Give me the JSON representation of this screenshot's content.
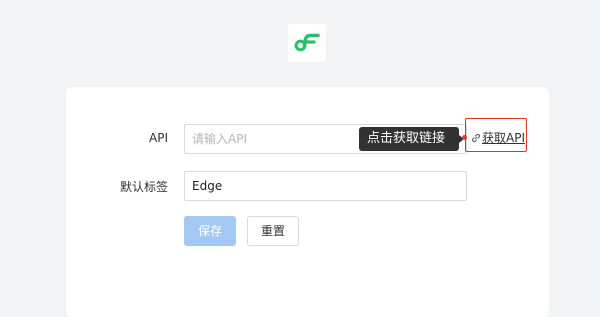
{
  "logo": {
    "icon": "brand-logo-icon",
    "color": "#2bbf6a"
  },
  "form": {
    "api_label": "API",
    "api_placeholder": "请输入API",
    "api_value": "",
    "tooltip": "点击获取链接",
    "get_api_icon": "link-icon",
    "get_api_label": "获取API",
    "tag_label": "默认标签",
    "tag_value": "Edge"
  },
  "actions": {
    "save_label": "保存",
    "reset_label": "重置"
  },
  "colors": {
    "background": "#f2f3f5",
    "card": "#ffffff",
    "primary_disabled": "#a4c8f3",
    "highlight": "#e0341f",
    "tooltip_bg": "#323232"
  }
}
